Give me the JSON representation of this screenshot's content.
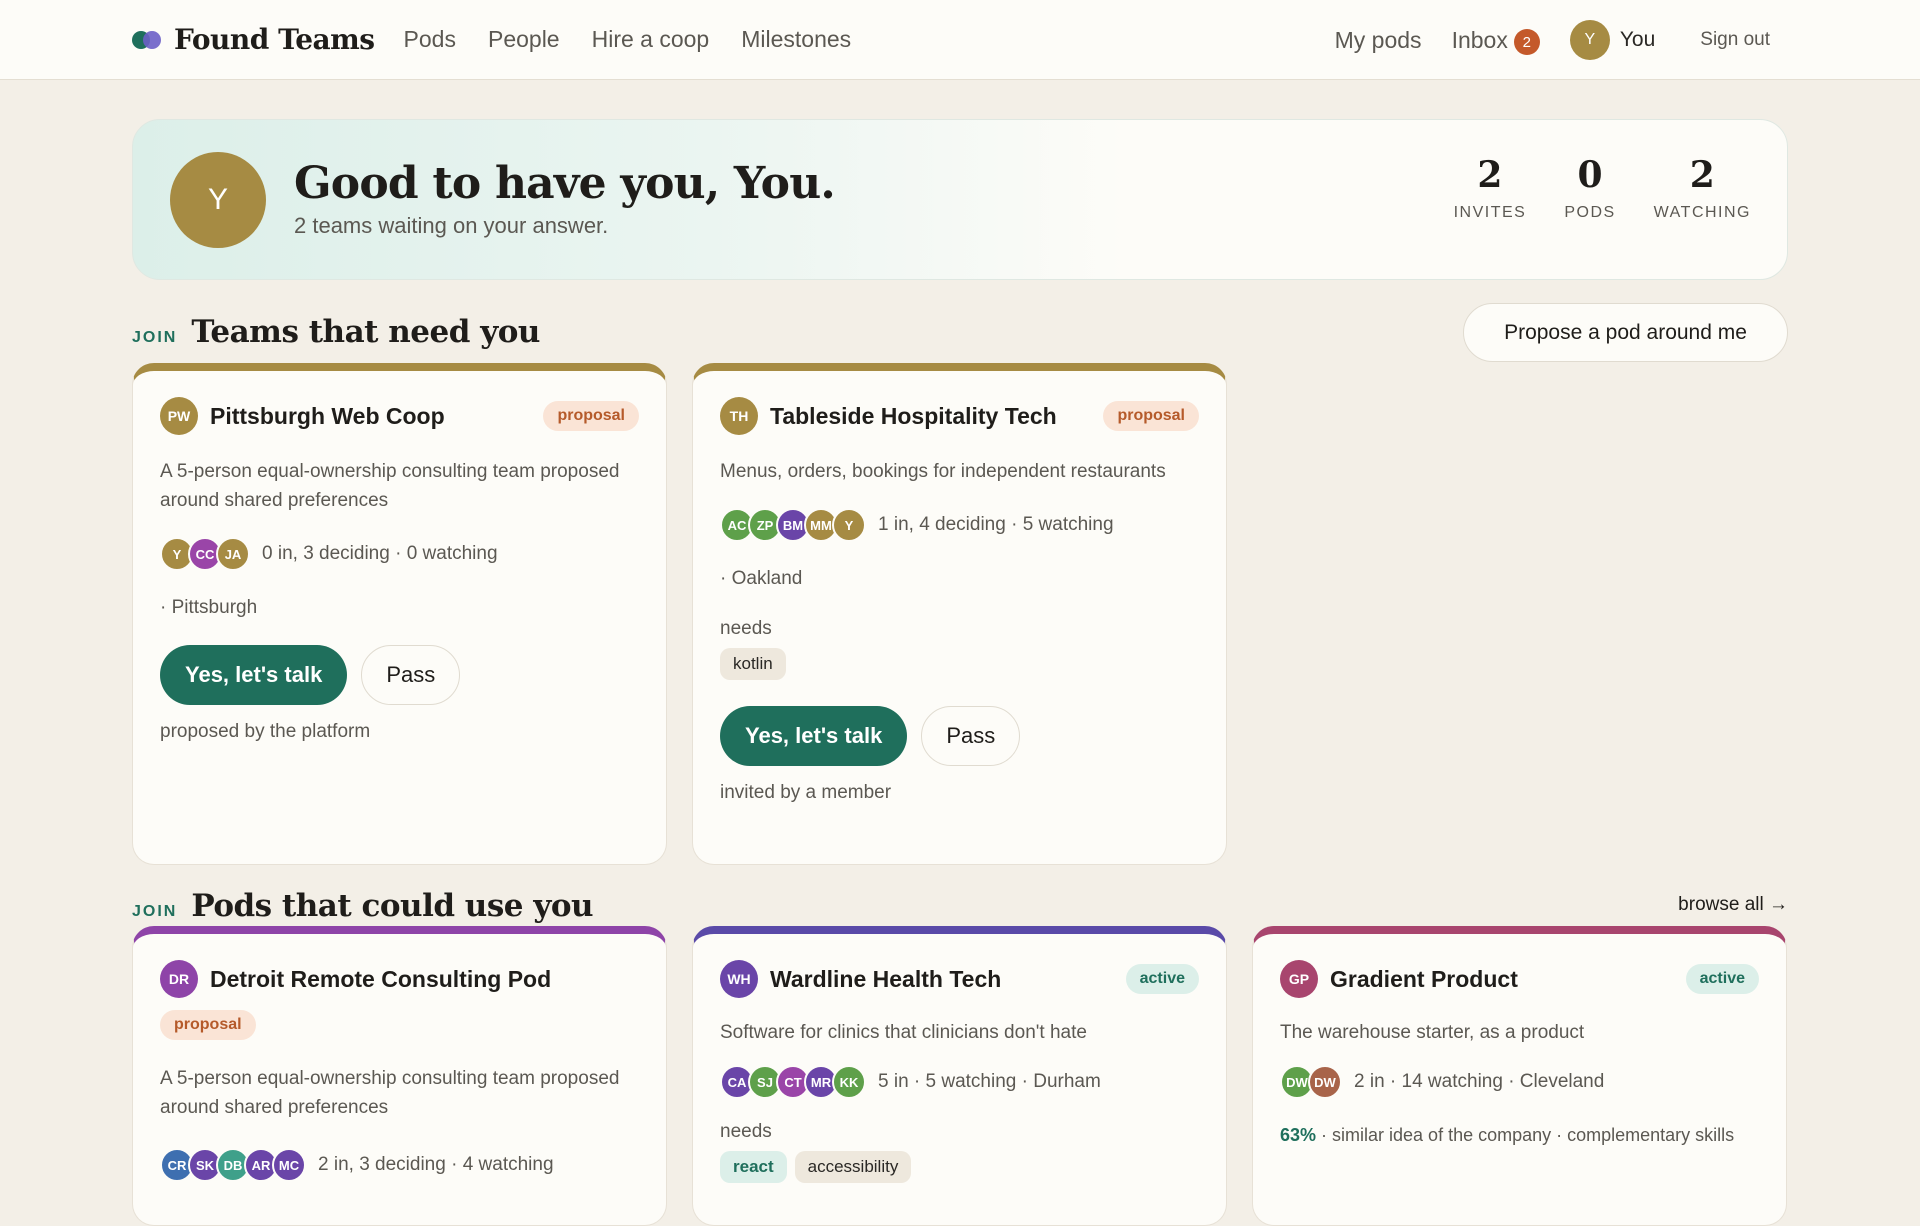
{
  "nav": {
    "brand": "Found Teams",
    "links": [
      "Pods",
      "People",
      "Hire a coop",
      "Milestones"
    ],
    "my_pods": "My pods",
    "inbox": "Inbox",
    "inbox_count": "2",
    "user_initial": "Y",
    "user_label": "You",
    "sign_out": "Sign out"
  },
  "hero": {
    "avatar_initial": "Y",
    "title": "Good to have you, You.",
    "subtitle": "2 teams waiting on your answer.",
    "stats": [
      {
        "value": "2",
        "label": "INVITES"
      },
      {
        "value": "0",
        "label": "PODS"
      },
      {
        "value": "2",
        "label": "WATCHING"
      }
    ]
  },
  "section_teams": {
    "eyebrow": "JOIN",
    "title": "Teams that need you",
    "propose_button": "Propose a pod around me",
    "cards": [
      {
        "initials": "PW",
        "avatar_color": "#a68b43",
        "accent": "#a68b43",
        "name": "Pittsburgh Web Coop",
        "status": "proposal",
        "desc": "A 5-person equal-ownership consulting team proposed around shared preferences",
        "members": [
          {
            "initials": "Y",
            "color": "#a68b43"
          },
          {
            "initials": "CC",
            "color": "#9a45a8"
          },
          {
            "initials": "JA",
            "color": "#a68b43"
          }
        ],
        "members_text": "0 in, 3 deciding · 0 watching",
        "location": "· Pittsburgh",
        "yes": "Yes, let's talk",
        "pass": "Pass",
        "footer": "proposed by the platform"
      },
      {
        "initials": "TH",
        "avatar_color": "#a68b43",
        "accent": "#a68b43",
        "name": "Tableside Hospitality Tech",
        "status": "proposal",
        "desc": "Menus, orders, bookings for independent restaurants",
        "members": [
          {
            "initials": "AC",
            "color": "#5ea04a"
          },
          {
            "initials": "ZP",
            "color": "#5ea04a"
          },
          {
            "initials": "BM",
            "color": "#6a45a8"
          },
          {
            "initials": "MM",
            "color": "#a68b43"
          },
          {
            "initials": "Y",
            "color": "#a68b43"
          }
        ],
        "members_text": "1 in, 4 deciding · 5 watching",
        "location": "· Oakland",
        "needs_label": "needs",
        "needs": [
          "kotlin"
        ],
        "yes": "Yes, let's talk",
        "pass": "Pass",
        "footer": "invited by a member"
      }
    ]
  },
  "section_pods": {
    "eyebrow": "JOIN",
    "title": "Pods that could use you",
    "browse_all": "browse all →",
    "cards": [
      {
        "initials": "DR",
        "avatar_color": "#8e44a8",
        "accent": "#8e44a8",
        "name": "Detroit Remote Consulting Pod",
        "status": "proposal",
        "desc": "A 5-person equal-ownership consulting team proposed around shared preferences",
        "members": [
          {
            "initials": "CR",
            "color": "#3e6fb0"
          },
          {
            "initials": "SK",
            "color": "#6a45a8"
          },
          {
            "initials": "DB",
            "color": "#3fa08a"
          },
          {
            "initials": "AR",
            "color": "#6a45a8"
          },
          {
            "initials": "MC",
            "color": "#6a45a8"
          }
        ],
        "members_text": "2 in, 3 deciding · 4 watching"
      },
      {
        "initials": "WH",
        "avatar_color": "#6a45a8",
        "accent": "#5a4aa8",
        "name": "Wardline Health Tech",
        "status": "active",
        "desc": "Software for clinics that clinicians don't hate",
        "members": [
          {
            "initials": "CA",
            "color": "#6a45a8"
          },
          {
            "initials": "SJ",
            "color": "#5ea04a"
          },
          {
            "initials": "CT",
            "color": "#9a45a8"
          },
          {
            "initials": "MR",
            "color": "#6a45a8"
          },
          {
            "initials": "KK",
            "color": "#5ea04a"
          }
        ],
        "members_text": "5 in · 5 watching  · Durham",
        "needs_label": "needs",
        "needs": [
          "react",
          "accessibility"
        ]
      },
      {
        "initials": "GP",
        "avatar_color": "#a8456e",
        "accent": "#a8456e",
        "name": "Gradient Product",
        "status": "active",
        "desc": "The warehouse starter, as a product",
        "members": [
          {
            "initials": "DW",
            "color": "#5ea04a"
          },
          {
            "initials": "DW",
            "color": "#a8644a"
          }
        ],
        "members_text": "2 in · 14 watching  · Cleveland",
        "match_pct": "63%",
        "match_text": " · similar idea of the company · complementary skills"
      }
    ]
  }
}
